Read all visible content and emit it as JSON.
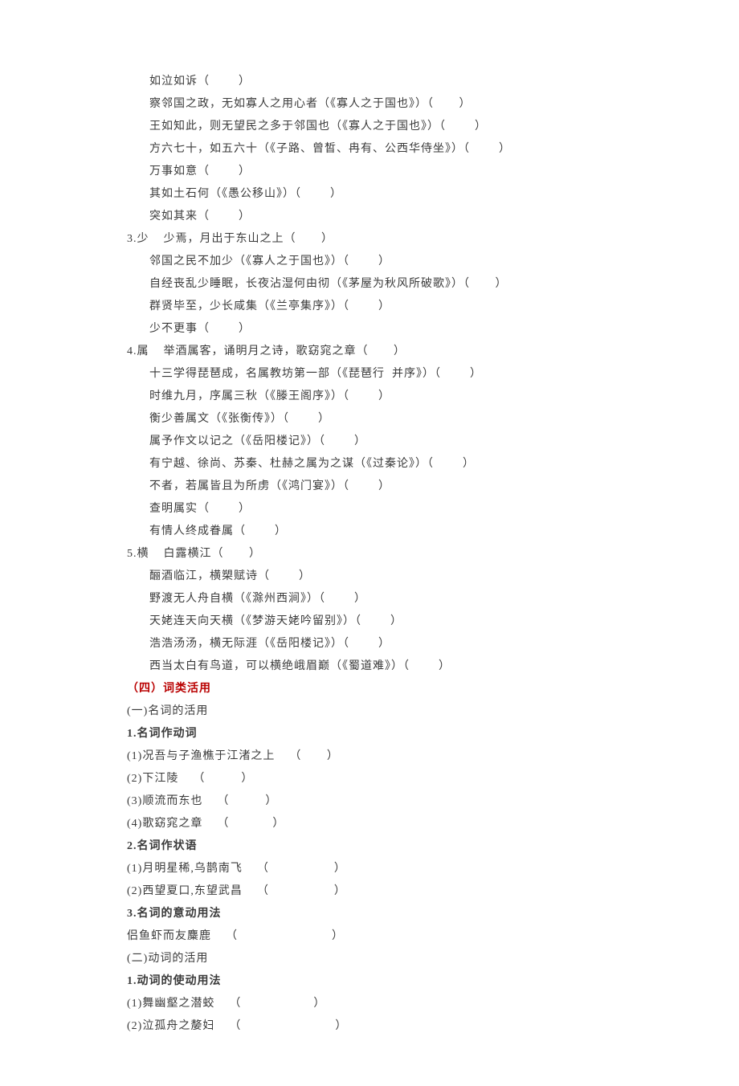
{
  "lines": [
    {
      "cls": "indent2",
      "text": "如泣如诉（        ）"
    },
    {
      "cls": "indent2",
      "text": "察邻国之政，无如寡人之用心者（《寡人之于国也》）（       ）"
    },
    {
      "cls": "indent2",
      "text": "王如知此，则无望民之多于邻国也（《寡人之于国也》）（        ）"
    },
    {
      "cls": "indent2",
      "text": "方六七十，如五六十（《子路、曾皙、冉有、公西华侍坐》）（        ）"
    },
    {
      "cls": "indent2",
      "text": "万事如意（        ）"
    },
    {
      "cls": "indent2",
      "text": "其如土石何（《愚公移山》）（        ）"
    },
    {
      "cls": "indent2",
      "text": "突如其来（        ）"
    },
    {
      "cls": "indent1",
      "text": "3.少    少焉，月出于东山之上（       ）"
    },
    {
      "cls": "indent2",
      "text": "邻国之民不加少（《寡人之于国也》）（        ）"
    },
    {
      "cls": "indent2",
      "text": "自经丧乱少睡眠，长夜沾湿何由彻（《茅屋为秋风所破歌》）（       ）"
    },
    {
      "cls": "indent2",
      "text": "群贤毕至，少长咸集（《兰亭集序》）（        ）"
    },
    {
      "cls": "indent2",
      "text": "少不更事（        ）"
    },
    {
      "cls": "indent1",
      "text": "4.属    举酒属客，诵明月之诗，歌窈窕之章（       ）"
    },
    {
      "cls": "indent2",
      "text": "十三学得琵琶成，名属教坊第一部（《琵琶行  并序》）（        ）"
    },
    {
      "cls": "indent2",
      "text": "时维九月，序属三秋（《滕王阁序》）（        ）"
    },
    {
      "cls": "indent2",
      "text": "衡少善属文（《张衡传》）（        ）"
    },
    {
      "cls": "indent2",
      "text": "属予作文以记之（《岳阳楼记》）（        ）"
    },
    {
      "cls": "indent2",
      "text": "有宁越、徐尚、苏秦、杜赫之属为之谋（《过秦论》）（        ）"
    },
    {
      "cls": "indent2",
      "text": "不者，若属皆且为所虏（《鸿门宴》）（        ）"
    },
    {
      "cls": "indent2",
      "text": "查明属实（        ）"
    },
    {
      "cls": "indent2",
      "text": "有情人终成眷属（        ）"
    },
    {
      "cls": "indent1",
      "text": "5.横    白露横江（       ）"
    },
    {
      "cls": "indent2",
      "text": "酾酒临江，横槊赋诗（        ）"
    },
    {
      "cls": "indent2",
      "text": "野渡无人舟自横（《滁州西涧》）（        ）"
    },
    {
      "cls": "indent2",
      "text": "天姥连天向天横（《梦游天姥吟留别》）（        ）"
    },
    {
      "cls": "indent2",
      "text": "浩浩汤汤，横无际涯（《岳阳楼记》）（        ）"
    },
    {
      "cls": "indent2",
      "text": "西当太白有鸟道，可以横绝峨眉巅（《蜀道难》）（        ）"
    },
    {
      "cls": "indent1 heading-red",
      "text": "（四）词类活用"
    },
    {
      "cls": "indent1",
      "text": "(一)名词的活用"
    },
    {
      "cls": "indent1 heading-bold",
      "text": "1.名词作动词"
    },
    {
      "cls": "indent1",
      "text": "(1)况吾与子渔樵于江渚之上    （       ）"
    },
    {
      "cls": "indent1",
      "text": "(2)下江陵    （          ）"
    },
    {
      "cls": "indent1",
      "text": "(3)顺流而东也    （          ）"
    },
    {
      "cls": "indent1",
      "text": "(4)歌窈窕之章    （            ）"
    },
    {
      "cls": "indent1 heading-bold",
      "text": "2.名词作状语"
    },
    {
      "cls": "indent1",
      "text": "(1)月明星稀,乌鹊南飞    （                  ）"
    },
    {
      "cls": "indent1",
      "text": "(2)西望夏口,东望武昌    （                  ）"
    },
    {
      "cls": "indent1 heading-bold",
      "text": "3.名词的意动用法"
    },
    {
      "cls": "indent1",
      "text": "侣鱼虾而友麋鹿    （                          ）"
    },
    {
      "cls": "indent1",
      "text": "(二)动词的活用"
    },
    {
      "cls": "indent1 heading-bold",
      "text": "1.动词的使动用法"
    },
    {
      "cls": "indent1",
      "text": "(1)舞幽壑之潜蛟    （                    ）"
    },
    {
      "cls": "indent1",
      "text": "(2)泣孤舟之嫠妇    （                          ）"
    }
  ]
}
